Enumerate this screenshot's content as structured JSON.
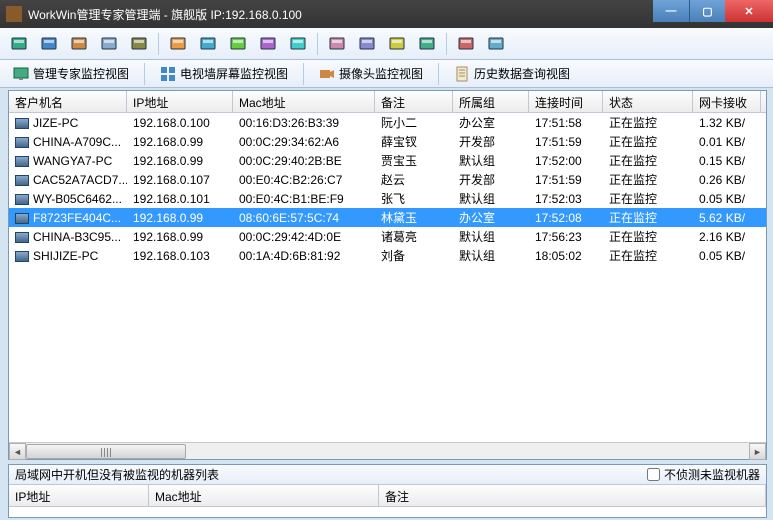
{
  "title": "WorkWin管理专家管理端 - 旗舰版 IP:192.168.0.100",
  "tabs": {
    "t1": "管理专家监控视图",
    "t2": "电视墙屏幕监控视图",
    "t3": "摄像头监控视图",
    "t4": "历史数据查询视图"
  },
  "columns": {
    "c0": "客户机名",
    "c1": "IP地址",
    "c2": "Mac地址",
    "c3": "备注",
    "c4": "所属组",
    "c5": "连接时间",
    "c6": "状态",
    "c7": "网卡接收"
  },
  "rows": [
    {
      "name": "JIZE-PC",
      "ip": "192.168.0.100",
      "mac": "00:16:D3:26:B3:39",
      "note": "阮小二",
      "group": "办公室",
      "time": "17:51:58",
      "status": "正在监控",
      "rx": "1.32 KB/",
      "sel": false
    },
    {
      "name": "CHINA-A709C...",
      "ip": "192.168.0.99",
      "mac": "00:0C:29:34:62:A6",
      "note": "薛宝钗",
      "group": "开发部",
      "time": "17:51:59",
      "status": "正在监控",
      "rx": "0.01 KB/",
      "sel": false
    },
    {
      "name": "WANGYA7-PC",
      "ip": "192.168.0.99",
      "mac": "00:0C:29:40:2B:BE",
      "note": "贾宝玉",
      "group": "默认组",
      "time": "17:52:00",
      "status": "正在监控",
      "rx": "0.15 KB/",
      "sel": false
    },
    {
      "name": "CAC52A7ACD7...",
      "ip": "192.168.0.107",
      "mac": "00:E0:4C:B2:26:C7",
      "note": "赵云",
      "group": "开发部",
      "time": "17:51:59",
      "status": "正在监控",
      "rx": "0.26 KB/",
      "sel": false
    },
    {
      "name": "WY-B05C6462...",
      "ip": "192.168.0.101",
      "mac": "00:E0:4C:B1:BE:F9",
      "note": "张飞",
      "group": "默认组",
      "time": "17:52:03",
      "status": "正在监控",
      "rx": "0.05 KB/",
      "sel": false
    },
    {
      "name": "F8723FE404C...",
      "ip": "192.168.0.99",
      "mac": "08:60:6E:57:5C:74",
      "note": "林黛玉",
      "group": "办公室",
      "time": "17:52:08",
      "status": "正在监控",
      "rx": "5.62 KB/",
      "sel": true
    },
    {
      "name": "CHINA-B3C95...",
      "ip": "192.168.0.99",
      "mac": "00:0C:29:42:4D:0E",
      "note": "诸葛亮",
      "group": "默认组",
      "time": "17:56:23",
      "status": "正在监控",
      "rx": "2.16 KB/",
      "sel": false
    },
    {
      "name": "SHIJIZE-PC",
      "ip": "192.168.0.103",
      "mac": "00:1A:4D:6B:81:92",
      "note": "刘备",
      "group": "默认组",
      "time": "18:05:02",
      "status": "正在监控",
      "rx": "0.05 KB/",
      "sel": false
    }
  ],
  "bottom": {
    "title": "局域网中开机但没有被监视的机器列表",
    "checkbox": "不侦测未监视机器",
    "cols": {
      "ip": "IP地址",
      "mac": "Mac地址",
      "note": "备注"
    }
  },
  "toolbar_icons": [
    "monitor-icon",
    "screen-icon",
    "windows-icon",
    "multiview-icon",
    "gear-icon",
    "folder-icon",
    "help-icon",
    "refresh-icon",
    "settings-icon",
    "globe-icon",
    "usb-icon",
    "log-icon",
    "export-icon",
    "list-icon",
    "user-icon",
    "session-icon"
  ]
}
